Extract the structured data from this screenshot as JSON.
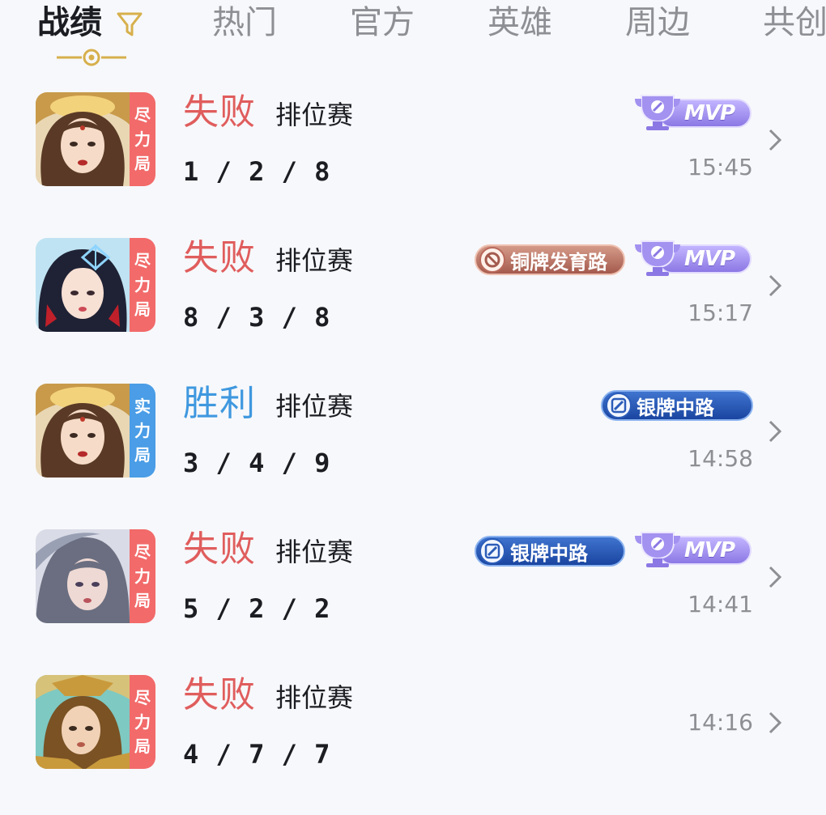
{
  "tabs": [
    {
      "label": "战绩",
      "active": true
    },
    {
      "label": "热门"
    },
    {
      "label": "官方"
    },
    {
      "label": "英雄"
    },
    {
      "label": "周边"
    },
    {
      "label": "共创"
    }
  ],
  "colors": {
    "loss": "#e05d5d",
    "win": "#3f98df",
    "loss_badge": "#f26a6a",
    "win_badge": "#4a9de6",
    "accent_gold": "#d7b04c",
    "mvp": "#9a87ea"
  },
  "matches": [
    {
      "result": "失败",
      "mode": "排位赛",
      "kda": "1 / 2 / 8",
      "time": "15:45",
      "badge": [
        "尽",
        "力",
        "局"
      ],
      "tags": [],
      "mvp": "MVP",
      "hero_icon": "hero-portrait-golden-headdress"
    },
    {
      "result": "失败",
      "mode": "排位赛",
      "kda": "8 / 3 / 8",
      "time": "15:17",
      "badge": [
        "尽",
        "力",
        "局"
      ],
      "tags": [
        {
          "label": "铜牌发育路",
          "icon": "no-sign-icon"
        }
      ],
      "mvp": "MVP",
      "hero_icon": "hero-portrait-dark-hair-bow"
    },
    {
      "result": "胜利",
      "mode": "排位赛",
      "kda": "3 / 4 / 9",
      "time": "14:58",
      "badge": [
        "实",
        "力",
        "局"
      ],
      "tags": [
        {
          "label": "银牌中路",
          "icon": "slash-icon"
        }
      ],
      "hero_icon": "hero-portrait-golden-headdress"
    },
    {
      "result": "失败",
      "mode": "排位赛",
      "kda": "5 / 2 / 2",
      "time": "14:41",
      "badge": [
        "尽",
        "力",
        "局"
      ],
      "tags": [
        {
          "label": "银牌中路",
          "icon": "slash-icon"
        }
      ],
      "mvp": "MVP",
      "hero_icon": "hero-portrait-silver-hair"
    },
    {
      "result": "失败",
      "mode": "排位赛",
      "kda": "4 / 7 / 7",
      "time": "14:16",
      "badge": [
        "尽",
        "力",
        "局"
      ],
      "tags": [],
      "hero_icon": "hero-portrait-gold-armor"
    }
  ]
}
